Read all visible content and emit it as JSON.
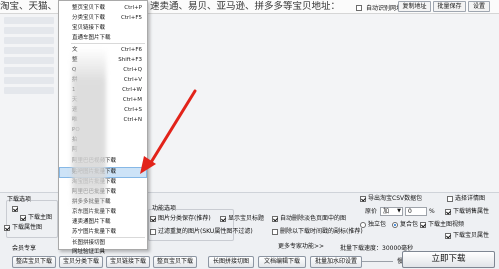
{
  "top": {
    "left_text": "淘宝、天猫、",
    "right_text": "速卖通、易贝、亚马逊、拼多多等宝贝地址：",
    "auto_download_label": "自动识别网址",
    "button_1": "复制地址",
    "button_2": "批量保存",
    "button_3": "设置"
  },
  "menu": {
    "items": [
      {
        "label": "整页宝贝下载",
        "shortcut": "Ctrl+P"
      },
      {
        "label": "分类宝贝下载",
        "shortcut": "Ctrl+F5"
      },
      {
        "label": "宝贝链接下载",
        "shortcut": ""
      },
      {
        "label": "直通车图片下载",
        "shortcut": ""
      },
      {
        "label": "文",
        "shortcut": "Ctrl+F6"
      },
      {
        "label": "整",
        "shortcut": "Shift+F3"
      },
      {
        "label": "Q",
        "shortcut": "Ctrl+Q"
      },
      {
        "label": "拼",
        "shortcut": "Ctrl+V"
      },
      {
        "label": "1",
        "shortcut": "Ctrl+W"
      },
      {
        "label": "天",
        "shortcut": "Ctrl+M"
      },
      {
        "label": "速",
        "shortcut": "Ctrl+S"
      },
      {
        "label": "唯",
        "shortcut": "Ctrl+N"
      },
      {
        "label": "PO",
        "shortcut": ""
      },
      {
        "label": "拍",
        "shortcut": ""
      },
      {
        "label": "阿",
        "shortcut": ""
      },
      {
        "label": "阿里巴巴视频下载",
        "shortcut": ""
      },
      {
        "label": "贴吧图片批量下载",
        "shortcut": ""
      },
      {
        "label": "淘宝图片批量下载",
        "shortcut": ""
      },
      {
        "label": "阿里巴巴批量下载",
        "shortcut": ""
      },
      {
        "label": "拼多多批量下载",
        "shortcut": ""
      },
      {
        "label": "京东图片批量下载",
        "shortcut": ""
      },
      {
        "label": "速卖通图片下载",
        "shortcut": ""
      },
      {
        "label": "苏宁图片批量下载",
        "shortcut": ""
      },
      {
        "label": "长图拼接切图",
        "shortcut": ""
      },
      {
        "label": "网址验证工具",
        "shortcut": ""
      }
    ],
    "highlighted_index": 16
  },
  "panel": {
    "download_options_title": "下载选项",
    "function_options_title": "功能选项",
    "download_main_image": "下载主图",
    "download_desc_image": "下载属性图",
    "opt_main_image_sku": "图片分类保存(推荐)",
    "opt_show_title": "显示宝贝标题",
    "opt_auto_remove_small": "自动删除淡色页面中的图",
    "opt_filter_repeat": "过滤重复的图片(SKU属性图不过滤)",
    "opt_auto_rename": "删除以下载时间戳的副标(推荐)",
    "more_label": "更多专家功能>>",
    "export_csv": "导出淘宝CSV数据包",
    "use_detail_page": "选择详情图",
    "mode_label": "原价",
    "mode_value": "加",
    "mode_number": "0",
    "mode_percent": "%",
    "sales_attr": "下载销售属性",
    "sole_package": "独立包",
    "combined_package": "复合包",
    "download_video": "下载主图视频",
    "download_option_attr": "下载宝贝属性",
    "member_zone": "会员专享",
    "speed_label": "批量下载速度：30000毫秒",
    "speed_slow": "快",
    "speed_fast": "慢",
    "start_button": "立即下载"
  },
  "bottom_buttons": [
    "整店宝贝下载",
    "宝贝分类下载",
    "宝贝链接下载",
    "整页宝贝下载",
    "长图拼接切图",
    "文档编辑下载",
    "批量加水印设置"
  ],
  "colors": {
    "menu_highlight": "#cde3f7",
    "arrow": "#e2231a",
    "accent_blue": "#1a6fd1"
  }
}
